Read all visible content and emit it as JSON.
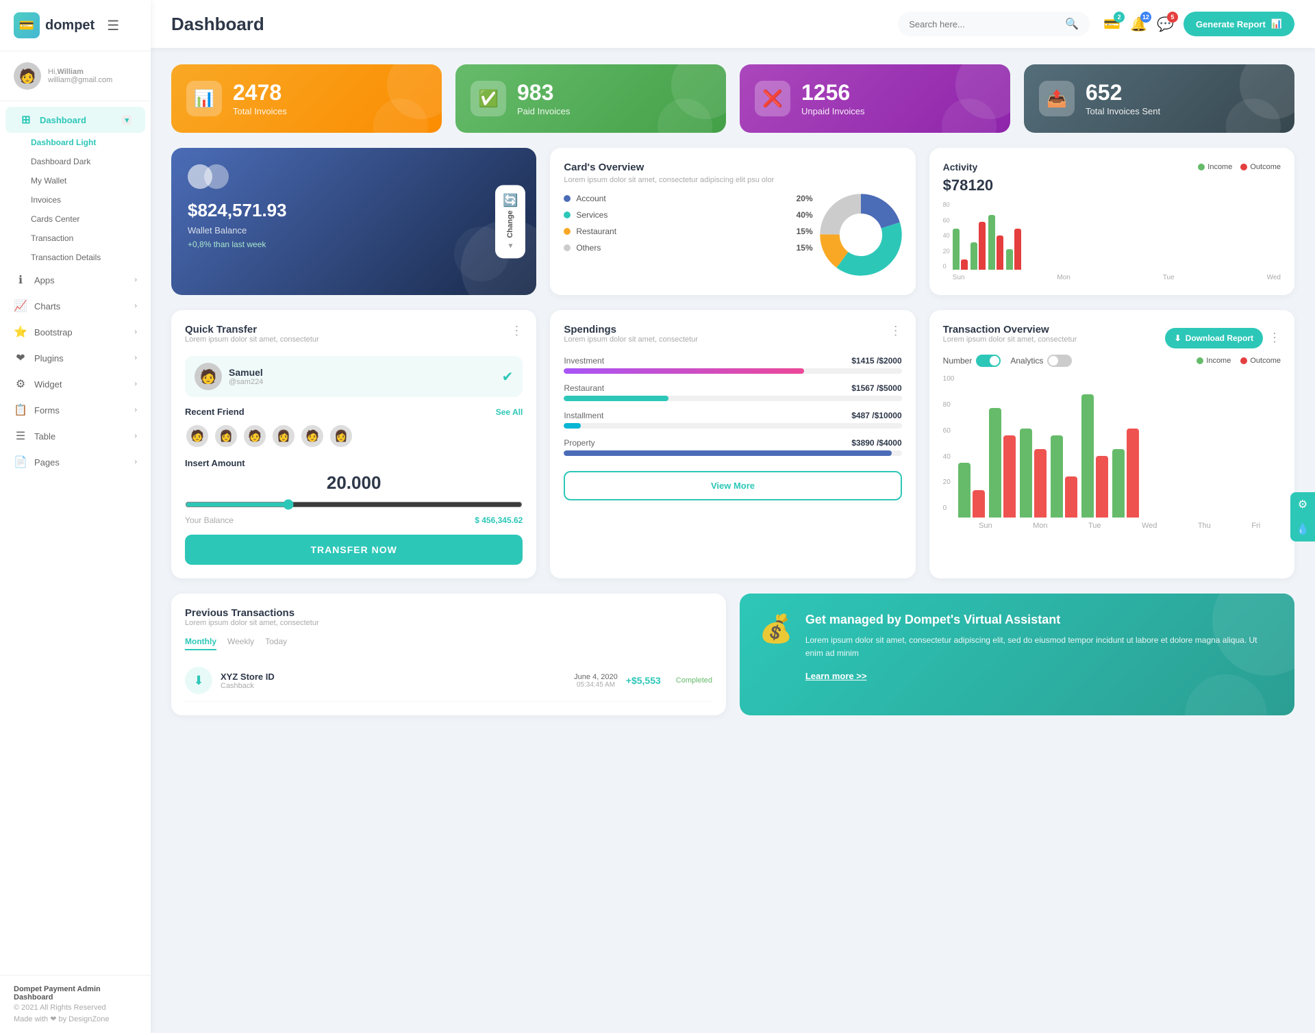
{
  "logo": {
    "icon": "💳",
    "text": "dompet"
  },
  "header": {
    "title": "Dashboard",
    "search_placeholder": "Search here...",
    "generate_btn": "Generate Report",
    "notifications": {
      "wallet_badge": "2",
      "bell_badge": "12",
      "chat_badge": "5"
    }
  },
  "sidebar": {
    "user": {
      "greeting": "Hi,",
      "name": "William",
      "email": "william@gmail.com"
    },
    "main_nav": {
      "label": "Dashboard",
      "active": true,
      "sub_items": [
        {
          "label": "Dashboard Light",
          "active": true
        },
        {
          "label": "Dashboard Dark",
          "active": false
        },
        {
          "label": "My Wallet",
          "active": false
        },
        {
          "label": "Invoices",
          "active": false
        },
        {
          "label": "Cards Center",
          "active": false
        },
        {
          "label": "Transaction",
          "active": false
        },
        {
          "label": "Transaction Details",
          "active": false
        }
      ]
    },
    "nav_items": [
      {
        "icon": "ℹ",
        "label": "Apps",
        "has_arrow": true
      },
      {
        "icon": "📈",
        "label": "Charts",
        "has_arrow": true
      },
      {
        "icon": "⭐",
        "label": "Bootstrap",
        "has_arrow": true
      },
      {
        "icon": "❤",
        "label": "Plugins",
        "has_arrow": true
      },
      {
        "icon": "⚙",
        "label": "Widget",
        "has_arrow": true
      },
      {
        "icon": "📋",
        "label": "Forms",
        "has_arrow": true
      },
      {
        "icon": "☰",
        "label": "Table",
        "has_arrow": true
      },
      {
        "icon": "📄",
        "label": "Pages",
        "has_arrow": true
      }
    ],
    "footer": {
      "brand": "Dompet Payment Admin Dashboard",
      "copyright": "© 2021 All Rights Reserved",
      "made_with": "Made with ❤ by DesignZone"
    }
  },
  "stats": [
    {
      "id": "total-invoices",
      "number": "2478",
      "label": "Total Invoices",
      "color": "orange",
      "icon": "📊"
    },
    {
      "id": "paid-invoices",
      "number": "983",
      "label": "Paid Invoices",
      "color": "green",
      "icon": "✅"
    },
    {
      "id": "unpaid-invoices",
      "number": "1256",
      "label": "Unpaid Invoices",
      "color": "purple",
      "icon": "❌"
    },
    {
      "id": "total-sent",
      "number": "652",
      "label": "Total Invoices Sent",
      "color": "blue-gray",
      "icon": "📤"
    }
  ],
  "wallet": {
    "circles": true,
    "amount": "$824,571.93",
    "label": "Wallet Balance",
    "change": "+0,8% than last week",
    "change_btn": "Change"
  },
  "cards_overview": {
    "title": "Card's Overview",
    "subtitle": "Lorem ipsum dolor sit amet, consectetur adipiscing elit psu olor",
    "items": [
      {
        "label": "Account",
        "pct": "20%",
        "color": "blue-d"
      },
      {
        "label": "Services",
        "pct": "40%",
        "color": "green-d"
      },
      {
        "label": "Restaurant",
        "pct": "15%",
        "color": "orange-d"
      },
      {
        "label": "Others",
        "pct": "15%",
        "color": "gray-d"
      }
    ],
    "pie": {
      "segments": [
        {
          "pct": 20,
          "color": "#4b6cb7"
        },
        {
          "pct": 40,
          "color": "#2dc7b8"
        },
        {
          "pct": 15,
          "color": "#f9a825"
        },
        {
          "pct": 25,
          "color": "#ccc"
        }
      ]
    }
  },
  "activity": {
    "title": "Activity",
    "amount": "$78120",
    "legend": [
      {
        "label": "Income",
        "color": "green"
      },
      {
        "label": "Outcome",
        "color": "red"
      }
    ],
    "bars": [
      {
        "day": "Sun",
        "income": 60,
        "outcome": 15
      },
      {
        "day": "Mon",
        "income": 40,
        "outcome": 70
      },
      {
        "day": "Tue",
        "income": 80,
        "outcome": 50
      },
      {
        "day": "Wed",
        "income": 30,
        "outcome": 60
      }
    ],
    "y_axis": [
      "0",
      "20",
      "40",
      "60",
      "80"
    ]
  },
  "quick_transfer": {
    "title": "Quick Transfer",
    "subtitle": "Lorem ipsum dolor sit amet, consectetur",
    "selected": {
      "name": "Samuel",
      "id": "@sam224",
      "avatar": "👤"
    },
    "recent_label": "Recent Friend",
    "see_all": "See All",
    "contacts": [
      "👤",
      "👤",
      "👤",
      "👤",
      "👤",
      "👤"
    ],
    "insert_label": "Insert Amount",
    "amount": "20.000",
    "balance_label": "Your Balance",
    "balance": "$ 456,345.62",
    "btn": "TRANSFER NOW"
  },
  "spendings": {
    "title": "Spendings",
    "subtitle": "Lorem ipsum dolor sit amet, consectetur",
    "items": [
      {
        "name": "Investment",
        "amount": "$1415",
        "max": "$2000",
        "pct": 71,
        "fill": "fill-purple"
      },
      {
        "name": "Restaurant",
        "amount": "$1567",
        "max": "$5000",
        "pct": 31,
        "fill": "fill-teal"
      },
      {
        "name": "Installment",
        "amount": "$487",
        "max": "$10000",
        "pct": 5,
        "fill": "fill-cyan"
      },
      {
        "name": "Property",
        "amount": "$3890",
        "max": "$4000",
        "pct": 97,
        "fill": "fill-blue-dark"
      }
    ],
    "btn": "View More"
  },
  "transaction_overview": {
    "title": "Transaction Overview",
    "subtitle": "Lorem ipsum dolor sit amet, consectetur",
    "download_btn": "Download Report",
    "toggles": [
      {
        "label": "Number",
        "on": true
      },
      {
        "label": "Analytics",
        "on": false
      }
    ],
    "legend": [
      {
        "label": "Income",
        "color": "green"
      },
      {
        "label": "Outcome",
        "color": "red"
      }
    ],
    "bars": [
      {
        "day": "Sun",
        "income": 40,
        "outcome": 20
      },
      {
        "day": "Mon",
        "income": 80,
        "outcome": 60
      },
      {
        "day": "Tue",
        "income": 65,
        "outcome": 50
      },
      {
        "day": "Wed",
        "income": 60,
        "outcome": 30
      },
      {
        "day": "Thu",
        "income": 90,
        "outcome": 45
      },
      {
        "day": "Fri",
        "income": 50,
        "outcome": 65
      }
    ],
    "y_axis": [
      "0",
      "20",
      "40",
      "60",
      "80",
      "100"
    ]
  },
  "previous_transactions": {
    "title": "Previous Transactions",
    "subtitle": "Lorem ipsum dolor sit amet, consectetur",
    "tabs": [
      "Monthly",
      "Weekly",
      "Today"
    ],
    "active_tab": "Monthly",
    "items": [
      {
        "name": "XYZ Store ID",
        "type": "Cashback",
        "date": "June 4, 2020",
        "time": "05:34:45 AM",
        "amount": "+$5,553",
        "status": "Completed",
        "icon": "⬇"
      }
    ]
  },
  "virtual_assistant": {
    "icon": "💰",
    "title": "Get managed by Dompet's Virtual Assistant",
    "desc": "Lorem ipsum dolor sit amet, consectetur adipiscing elit, sed do eiusmod tempor incidunt ut labore et dolore magna aliqua. Ut enim ad minim",
    "link": "Learn more >>"
  },
  "float_buttons": [
    {
      "icon": "⚙",
      "id": "settings"
    },
    {
      "icon": "💧",
      "id": "theme"
    }
  ]
}
